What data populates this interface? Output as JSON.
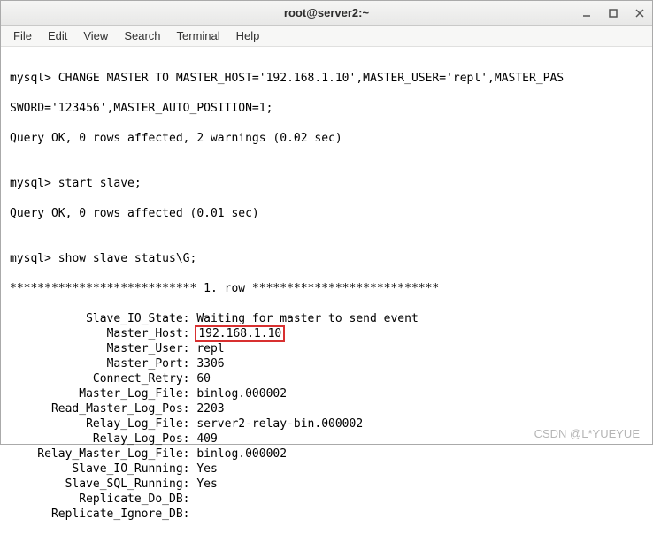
{
  "window": {
    "title": "root@server2:~"
  },
  "menu": {
    "file": "File",
    "edit": "Edit",
    "view": "View",
    "search": "Search",
    "terminal": "Terminal",
    "help": "Help"
  },
  "term": {
    "line1": "mysql> CHANGE MASTER TO MASTER_HOST='192.168.1.10',MASTER_USER='repl',MASTER_PAS",
    "line2": "SWORD='123456',MASTER_AUTO_POSITION=1;",
    "line3": "Query OK, 0 rows affected, 2 warnings (0.02 sec)",
    "blank1": "",
    "line4": "mysql> start slave;",
    "line5": "Query OK, 0 rows affected (0.01 sec)",
    "blank2": "",
    "line6": "mysql> show slave status\\G;",
    "line7": "*************************** 1. row ***************************",
    "status": [
      {
        "label": "Slave_IO_State",
        "value": "Waiting for master to send event",
        "hl": false
      },
      {
        "label": "Master_Host",
        "value": "192.168.1.10",
        "hl": true
      },
      {
        "label": "Master_User",
        "value": "repl",
        "hl": false
      },
      {
        "label": "Master_Port",
        "value": "3306",
        "hl": false
      },
      {
        "label": "Connect_Retry",
        "value": "60",
        "hl": false
      },
      {
        "label": "Master_Log_File",
        "value": "binlog.000002",
        "hl": false
      },
      {
        "label": "Read_Master_Log_Pos",
        "value": "2203",
        "hl": false
      },
      {
        "label": "Relay_Log_File",
        "value": "server2-relay-bin.000002",
        "hl": false
      },
      {
        "label": "Relay_Log_Pos",
        "value": "409",
        "hl": false
      },
      {
        "label": "Relay_Master_Log_File",
        "value": "binlog.000002",
        "hl": false
      },
      {
        "label": "Slave_IO_Running",
        "value": "Yes",
        "hl": false
      },
      {
        "label": "Slave_SQL_Running",
        "value": "Yes",
        "hl": false
      },
      {
        "label": "Replicate_Do_DB",
        "value": "",
        "hl": false
      },
      {
        "label": "Replicate_Ignore_DB",
        "value": "",
        "hl": false
      }
    ]
  },
  "watermark": "CSDN @L*YUEYUE"
}
